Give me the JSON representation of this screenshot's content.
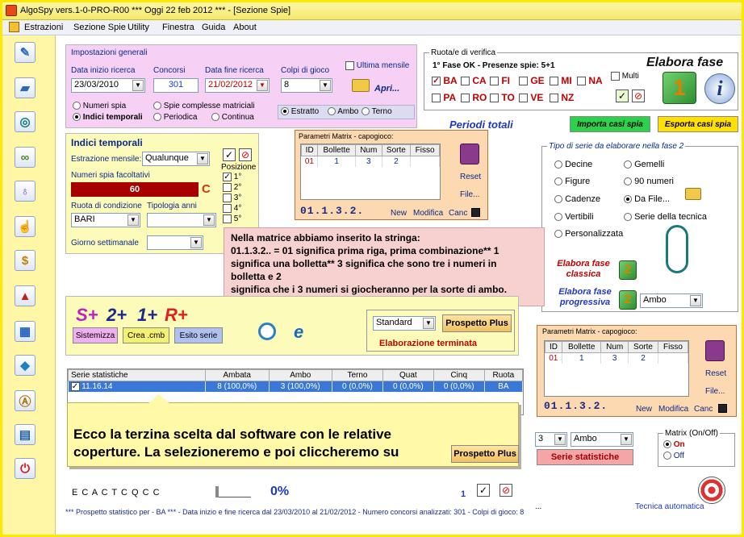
{
  "titlebar": {
    "title": "AlgoSpy vers.1-0-PRO-R00  ***  Oggi 22 feb 2012  ***   - [Sezione Spie]"
  },
  "menu": [
    "Estrazioni",
    "Sezione Spie",
    "Utility",
    "Finestra",
    "Guida",
    "About"
  ],
  "toolbar_icons": [
    "pencil-icon",
    "eraser-icon",
    "compass-icon",
    "binoculars-icon",
    "lightbulb-icon",
    "hand-icon",
    "dollar-icon",
    "pyramid-icon",
    "calendar-icon",
    "drop-icon",
    "letter-a-icon",
    "book-icon",
    "power-icon"
  ],
  "impostazioni": {
    "title": "Impostazioni generali",
    "data_inizio_label": "Data inizio ricerca",
    "data_inizio": "23/03/2010",
    "concorsi_label": "Concorsi",
    "concorsi": "301",
    "data_fine_label": "Data fine ricerca",
    "data_fine": "21/02/2012",
    "colpi_label": "Colpi di gioco",
    "colpi": "8",
    "ultima_mensile": "Ultima mensile",
    "apri": "Apri...",
    "numeri_spia": "Numeri spia",
    "spie_complesse": "Spie complesse matriciali",
    "indici_temporali": "Indici temporali",
    "periodica": "Periodica",
    "continua": "Continua",
    "estratto": "Estratto",
    "ambo": "Ambo",
    "terno": "Terno"
  },
  "indici": {
    "title": "Indici temporali",
    "estrazione_label": "Estrazione mensile:",
    "estrazione": "Qualunque",
    "numeri_fac_label": "Numeri spia facoltativi",
    "numeri_fac": "60",
    "c_letter": "C",
    "ruota_label": "Ruota di condizione",
    "ruota": "BARI",
    "tipologia_label": "Tipologia anni",
    "giorno_label": "Giorno settimanale",
    "posizione": "Posizione",
    "posizioni": [
      "1°",
      "2°",
      "3°",
      "4°",
      "5°"
    ]
  },
  "matrix1": {
    "title": "Parametri Matrix - capogioco:",
    "headers": [
      "ID",
      "Bollette",
      "Num",
      "Sorte",
      "Fisso"
    ],
    "row": [
      "01",
      "1",
      "3",
      "2",
      ""
    ],
    "reset": "Reset",
    "file": "File...",
    "code": "01.1.3.2.",
    "nuovo": "New",
    "modifica": "Modifica",
    "canc": "Canc"
  },
  "ruote": {
    "title": "Ruota/e di verifica",
    "fase": "1° Fase OK - Presenze spie: 5+1",
    "row1": [
      "BA",
      "CA",
      "FI",
      "GE",
      "MI",
      "NA"
    ],
    "row2": [
      "PA",
      "RO",
      "TO",
      "VE",
      "NZ"
    ],
    "multi": "Multi"
  },
  "elabora": {
    "title": "Elabora fase",
    "num": "1"
  },
  "periodi": "Periodi totali",
  "importa": "Importa casi spia",
  "esporta": "Esporta casi spia",
  "tipo": {
    "title": "Tipo di serie da elaborare nella fase 2",
    "options_left": [
      "Decine",
      "Figure",
      "Cadenze",
      "Vertibili",
      "Personalizzata"
    ],
    "options_right": [
      "Gemelli",
      "90 numeri",
      "Da File...",
      "Serie della tecnica"
    ]
  },
  "fase2": {
    "classica": "Elabora fase classica",
    "progressiva": "Elabora fase progressiva",
    "num": "2",
    "sorte": "Ambo"
  },
  "note": {
    "lines": [
      "Nella matrice abbiamo inserito la stringa:",
      "01.1.3.2.. = 01 significa prima riga, prima combinazione** 1",
      "significa una bolletta** 3 significa che sono tre i numeri in",
      "bolletta e 2",
      "significa che i 3 numeri si giocheranno per la sorte di ambo."
    ]
  },
  "splus": {
    "s": "S+",
    "two": "2+",
    "one": "1+",
    "r": "R+",
    "sistemizza": "Sistemizza",
    "crea": "Crea .cmb",
    "esito": "Esito serie",
    "standard": "Standard",
    "prospetto": "Prospetto Plus",
    "elaborazione": "Elaborazione terminata"
  },
  "matrix2": {
    "title": "Parametri Matrix - capogioco:",
    "headers": [
      "ID",
      "Bollette",
      "Num",
      "Sorte",
      "Fisso"
    ],
    "row": [
      "01",
      "1",
      "3",
      "2",
      ""
    ],
    "reset": "Reset",
    "file": "File...",
    "code": "01.1.3.2.",
    "nuovo": "New",
    "modifica": "Modifica",
    "canc": "Canc"
  },
  "stats": {
    "headers": [
      "Serie statistiche",
      "Ambata",
      "Ambo",
      "Terno",
      "Quat",
      "Cinq",
      "Ruota"
    ],
    "row": [
      "11.16.14",
      "8 (100,0%)",
      "3 (100,0%)",
      "0 (0,0%)",
      "0 (0,0%)",
      "0 (0,0%)",
      "BA"
    ]
  },
  "callout": {
    "line1": "Ecco la terzina scelta dal software con le relative",
    "line2": "coperture. La selezioneremo e poi cliccheremo su",
    "button": "Prospetto Plus"
  },
  "lower_right": {
    "num": "3",
    "sorte": "Ambo",
    "serie_stat": "Serie statistiche",
    "matrix_onoff": "Matrix (On/Off)",
    "on": "On",
    "off": "Off",
    "tecnica": "Tecnica automatica",
    "dots": "..."
  },
  "bottom": {
    "radios": "E C A C T C Q C C",
    "percent": "0%",
    "count": "1",
    "status": "*** Prospetto statistico per  - BA ***  - Data inizio e fine ricerca dal 23/03/2010 al 21/02/2012 - Numero concorsi analizzati: 301 - Colpi di gioco: 8"
  }
}
